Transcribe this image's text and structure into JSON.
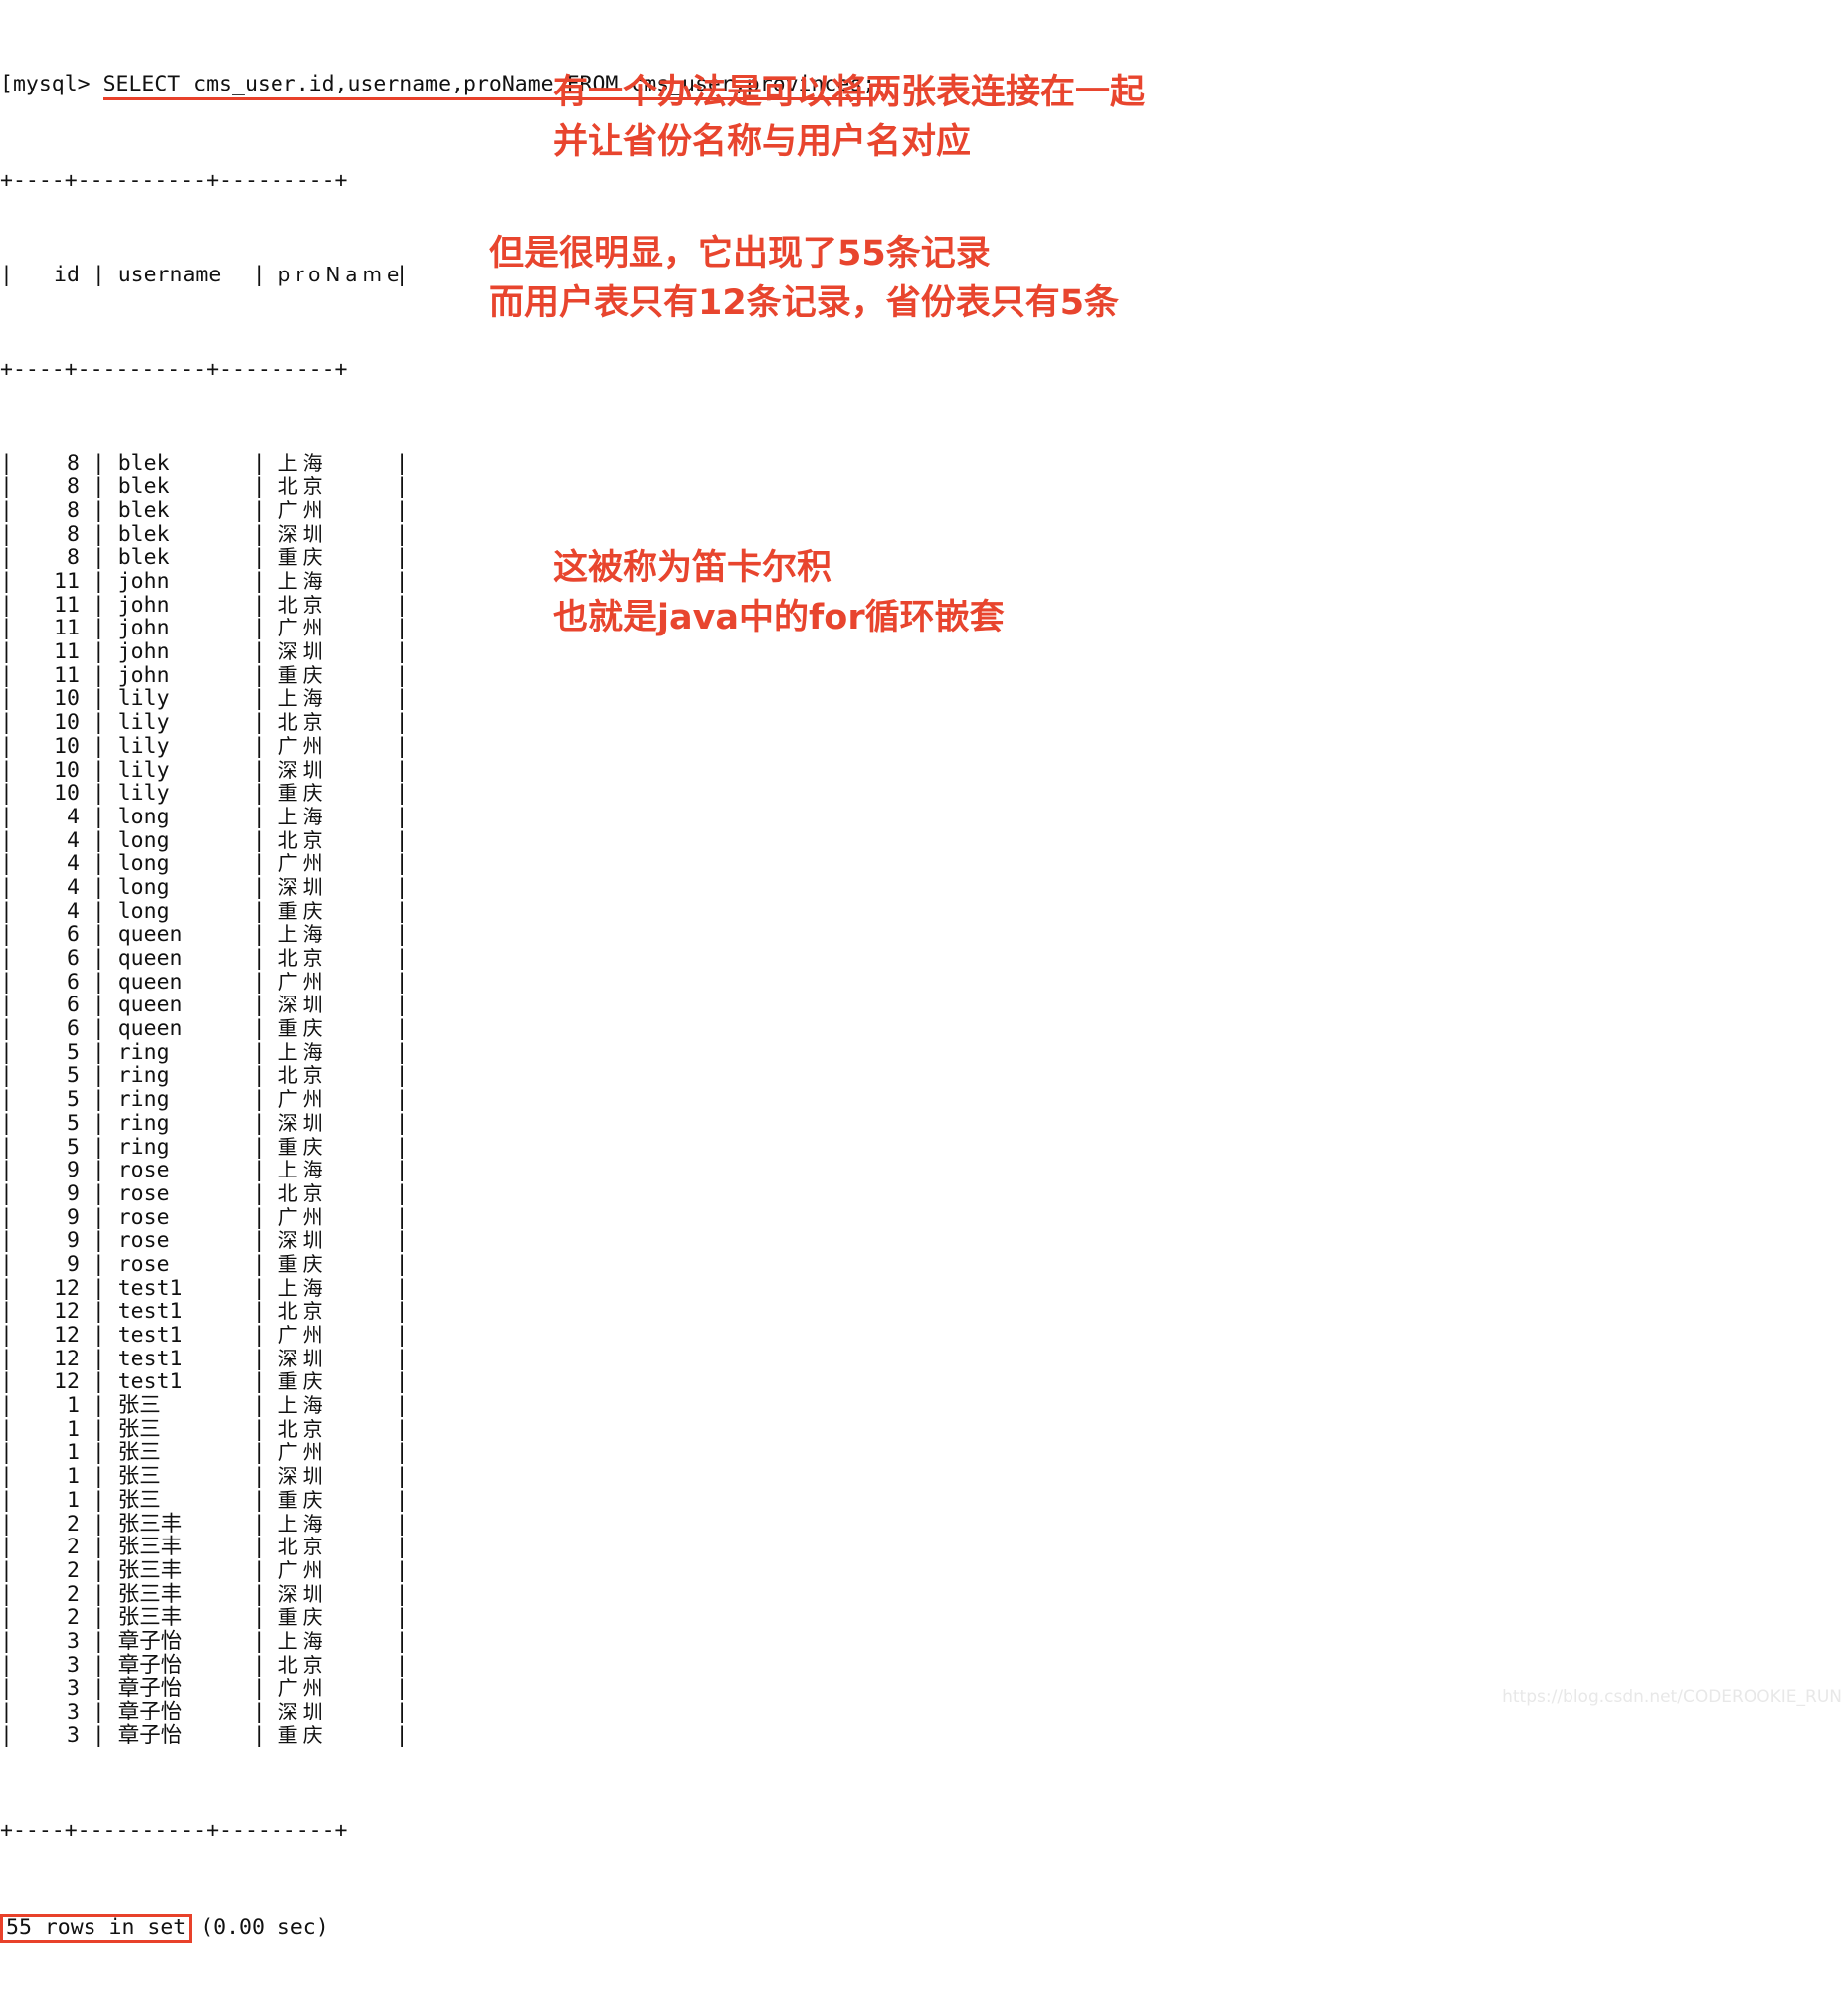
{
  "terminal": {
    "prompt": "[mysql> ",
    "sql": "SELECT cms_user.id,username,proName FROM cms_user,provinces;",
    "separator": "+----+----------+---------+",
    "header": {
      "id": "id",
      "username": "username",
      "proname": "proName"
    },
    "footer": {
      "rows_badge": "55 rows in set",
      "timing": "(0.00 sec)"
    }
  },
  "table": {
    "columns": [
      "id",
      "username",
      "proName"
    ],
    "provinces": [
      "上海",
      "北京",
      "广州",
      "深圳",
      "重庆"
    ],
    "users": [
      {
        "id": "8",
        "username": "blek"
      },
      {
        "id": "11",
        "username": "john"
      },
      {
        "id": "10",
        "username": "lily"
      },
      {
        "id": "4",
        "username": "long"
      },
      {
        "id": "6",
        "username": "queen"
      },
      {
        "id": "5",
        "username": "ring"
      },
      {
        "id": "9",
        "username": "rose"
      },
      {
        "id": "12",
        "username": "test1"
      },
      {
        "id": "1",
        "username": "张三"
      },
      {
        "id": "2",
        "username": "张三丰"
      },
      {
        "id": "3",
        "username": "章子怡"
      }
    ],
    "row_count": 55
  },
  "annotations": [
    {
      "id": "annotation-1",
      "lines": [
        "有一个办法是可以将两张表连接在一起",
        "并让省份名称与用户名对应"
      ]
    },
    {
      "id": "annotation-2",
      "lines": [
        "但是很明显，它出现了55条记录",
        "而用户表只有12条记录，省份表只有5条"
      ]
    },
    {
      "id": "annotation-3",
      "lines": [
        "这被称为笛卡尔积",
        "也就是java中的for循环嵌套"
      ]
    }
  ],
  "colors": {
    "annotation_red": "#e8452e",
    "highlight_red": "#e8412a",
    "terminal_text": "#111111",
    "watermark": "#e8e8e8"
  },
  "watermark": "https://blog.csdn.net/CODEROOKIE_RUN"
}
